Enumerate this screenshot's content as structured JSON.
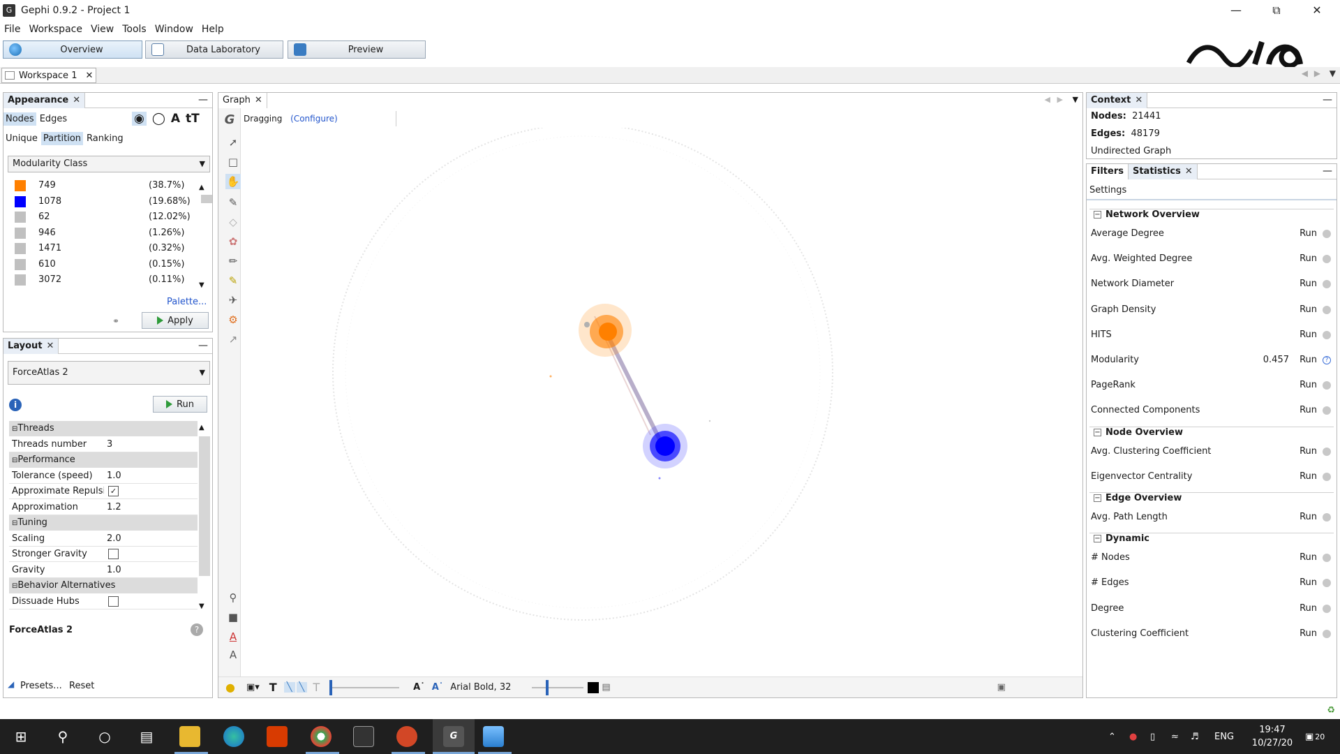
{
  "window": {
    "title": "Gephi 0.9.2 - Project 1",
    "app_icon": "gephi-icon"
  },
  "menu": [
    "File",
    "Workspace",
    "View",
    "Tools",
    "Window",
    "Help"
  ],
  "modes": [
    {
      "label": "Overview",
      "icon": "globe-icon",
      "active": true
    },
    {
      "label": "Data Laboratory",
      "icon": "table-icon",
      "active": false
    },
    {
      "label": "Preview",
      "icon": "monitor-icon",
      "active": false
    }
  ],
  "workspace_tab": "Workspace 1",
  "appearance": {
    "title": "Appearance",
    "element_tabs": [
      "Nodes",
      "Edges"
    ],
    "mode_tabs": [
      "Unique",
      "Partition",
      "Ranking"
    ],
    "attribute": "Modularity Class",
    "partitions": [
      {
        "label": "749",
        "pct": "(38.7%)",
        "color": "#ff8000"
      },
      {
        "label": "1078",
        "pct": "(19.68%)",
        "color": "#0000ff"
      },
      {
        "label": "62",
        "pct": "(12.02%)",
        "color": "#c0c0c0"
      },
      {
        "label": "946",
        "pct": "(1.26%)",
        "color": "#c0c0c0"
      },
      {
        "label": "1471",
        "pct": "(0.32%)",
        "color": "#c0c0c0"
      },
      {
        "label": "610",
        "pct": "(0.15%)",
        "color": "#c0c0c0"
      },
      {
        "label": "3072",
        "pct": "(0.11%)",
        "color": "#c0c0c0"
      }
    ],
    "palette_link": "Palette...",
    "apply_label": "Apply"
  },
  "layout": {
    "title": "Layout",
    "algorithm": "ForceAtlas 2",
    "run_label": "Run",
    "properties": [
      {
        "type": "cat",
        "label": "Threads"
      },
      {
        "type": "val",
        "key": "Threads number",
        "value": "3"
      },
      {
        "type": "cat",
        "label": "Performance"
      },
      {
        "type": "val",
        "key": "Tolerance (speed)",
        "value": "1.0"
      },
      {
        "type": "chk",
        "key": "Approximate Repulsion",
        "checked": true
      },
      {
        "type": "val",
        "key": "Approximation",
        "value": "1.2"
      },
      {
        "type": "cat",
        "label": "Tuning"
      },
      {
        "type": "val",
        "key": "Scaling",
        "value": "2.0"
      },
      {
        "type": "chk",
        "key": "Stronger Gravity",
        "checked": false
      },
      {
        "type": "val",
        "key": "Gravity",
        "value": "1.0"
      },
      {
        "type": "cat",
        "label": "Behavior Alternatives"
      },
      {
        "type": "chk",
        "key": "Dissuade Hubs",
        "checked": false
      }
    ],
    "desc_title": "ForceAtlas 2",
    "presets_label": "Presets...",
    "reset_label": "Reset"
  },
  "graph": {
    "title": "Graph",
    "mode_label": "Dragging",
    "configure_label": "(Configure)",
    "font_label": "Arial Bold, 32"
  },
  "context": {
    "title": "Context",
    "nodes_label": "Nodes:",
    "nodes_value": "21441",
    "edges_label": "Edges:",
    "edges_value": "48179",
    "graph_type": "Undirected Graph"
  },
  "statistics": {
    "tabs": [
      "Filters",
      "Statistics"
    ],
    "settings_label": "Settings",
    "run_label": "Run",
    "sections": [
      {
        "title": "Network Overview",
        "items": [
          {
            "name": "Average Degree",
            "value": ""
          },
          {
            "name": "Avg. Weighted Degree",
            "value": ""
          },
          {
            "name": "Network Diameter",
            "value": ""
          },
          {
            "name": "Graph Density",
            "value": ""
          },
          {
            "name": "HITS",
            "value": ""
          },
          {
            "name": "Modularity",
            "value": "0.457"
          },
          {
            "name": "PageRank",
            "value": ""
          },
          {
            "name": "Connected Components",
            "value": ""
          }
        ]
      },
      {
        "title": "Node Overview",
        "items": [
          {
            "name": "Avg. Clustering Coefficient",
            "value": ""
          },
          {
            "name": "Eigenvector Centrality",
            "value": ""
          }
        ]
      },
      {
        "title": "Edge Overview",
        "items": [
          {
            "name": "Avg. Path Length",
            "value": ""
          }
        ]
      },
      {
        "title": "Dynamic",
        "items": [
          {
            "name": "# Nodes",
            "value": ""
          },
          {
            "name": "# Edges",
            "value": ""
          },
          {
            "name": "Degree",
            "value": ""
          },
          {
            "name": "Clustering Coefficient",
            "value": ""
          }
        ]
      }
    ]
  },
  "taskbar": {
    "lang": "ENG",
    "time": "19:47",
    "date": "10/27/20",
    "notifications": "20"
  }
}
